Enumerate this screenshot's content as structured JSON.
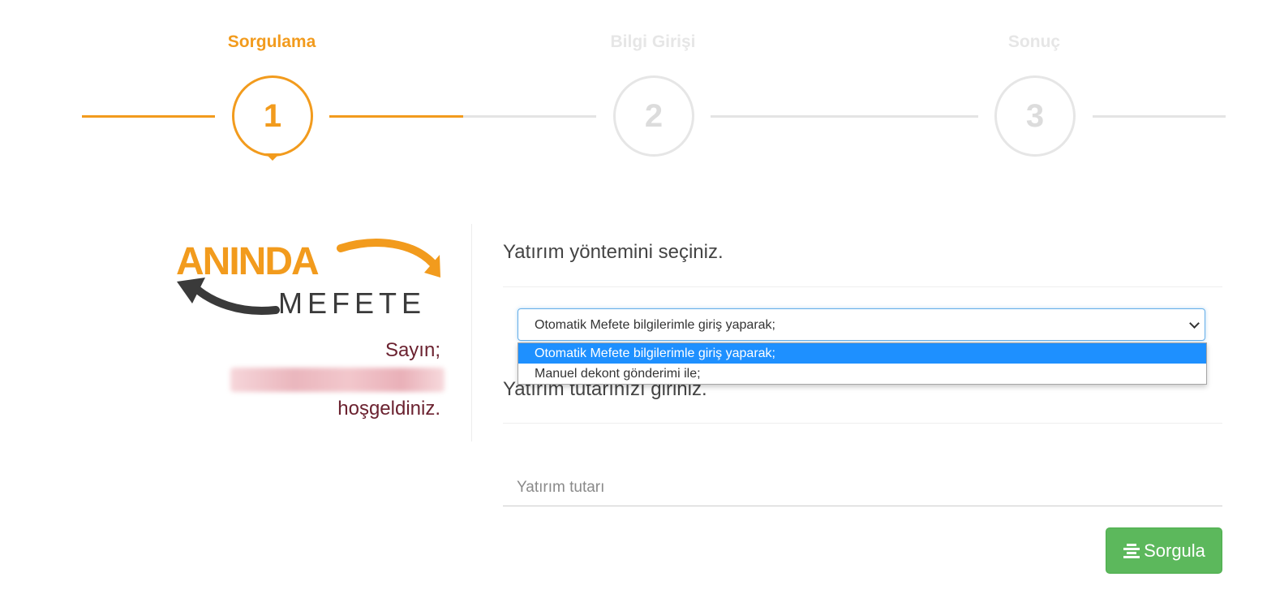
{
  "stepper": {
    "steps": [
      {
        "label": "Sorgulama",
        "number": "1",
        "active": true
      },
      {
        "label": "Bilgi Girişi",
        "number": "2",
        "active": false
      },
      {
        "label": "Sonuç",
        "number": "3",
        "active": false
      }
    ]
  },
  "brand": {
    "logo_top_text": "ANINDA",
    "logo_bottom_text": "MEFETE",
    "colors": {
      "orange": "#f29b1d",
      "dark": "#3a3a3a",
      "welcome_text": "#6b2230",
      "success": "#5cb85c",
      "option_highlight": "#1e90ff"
    }
  },
  "welcome": {
    "greeting": "Sayın;",
    "suffix": "hoşgeldiniz."
  },
  "form": {
    "method_title": "Yatırım yöntemini seçiniz.",
    "method_select": {
      "value": "Otomatik Mefete bilgilerimle giriş yaparak;",
      "options": [
        "Otomatik Mefete bilgilerimle giriş yaparak;",
        "Manuel dekont gönderimi ile;"
      ]
    },
    "amount_title": "Yatırım tutarınızı giriniz.",
    "amount_input": {
      "value": "",
      "placeholder": "Yatırım tutarı"
    },
    "submit_label": "Sorgula",
    "submit_icon": "align-center-icon"
  }
}
